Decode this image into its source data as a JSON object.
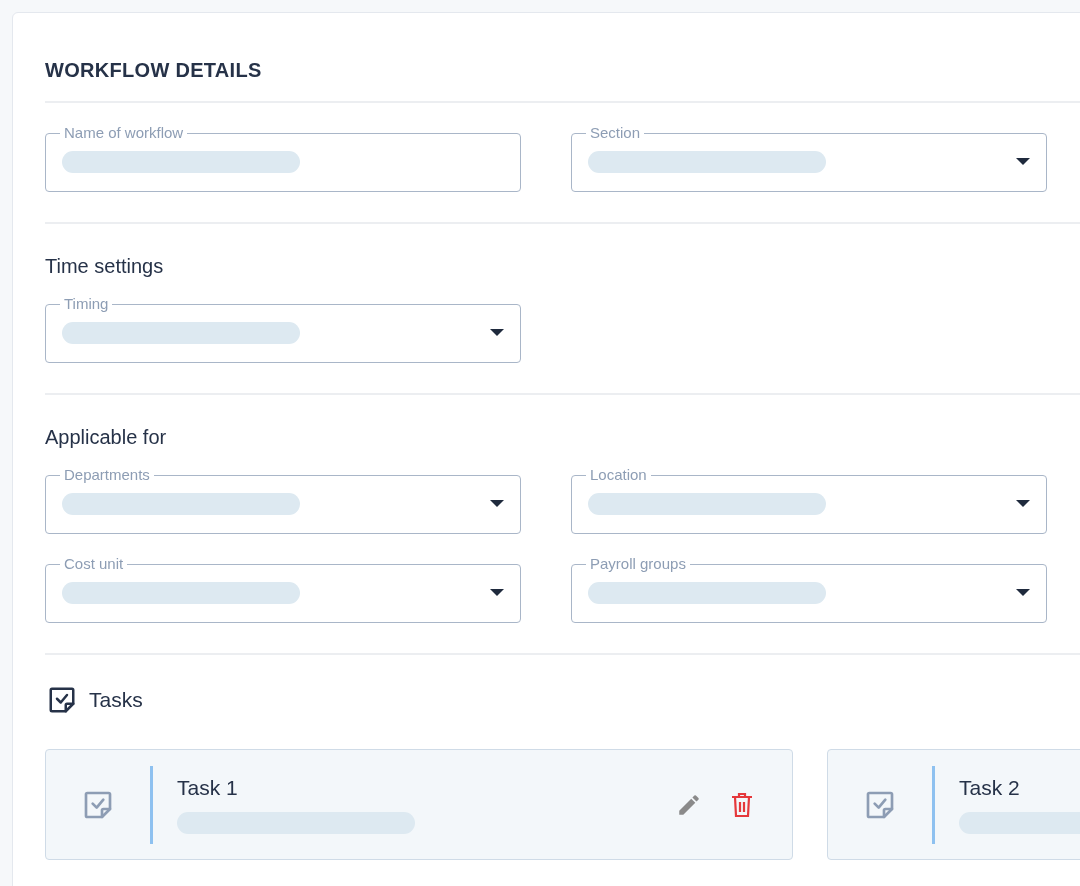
{
  "page_title": "WORKFLOW DETAILS",
  "sections": [
    {
      "fields": [
        {
          "label": "Name of workflow",
          "kind": "text"
        },
        {
          "label": "Section",
          "kind": "select"
        }
      ]
    },
    {
      "heading": "Time settings",
      "fields": [
        {
          "label": "Timing",
          "kind": "select"
        }
      ]
    },
    {
      "heading": "Applicable for",
      "fields": [
        {
          "label": "Departments",
          "kind": "select"
        },
        {
          "label": "Location",
          "kind": "select"
        },
        {
          "label": "Cost unit",
          "kind": "select"
        },
        {
          "label": "Payroll groups",
          "kind": "select"
        }
      ]
    }
  ],
  "tasks_section": {
    "heading": "Tasks",
    "tasks": [
      {
        "title": "Task 1",
        "actions_visible": true
      },
      {
        "title": "Task 2",
        "actions_visible": false
      }
    ]
  }
}
